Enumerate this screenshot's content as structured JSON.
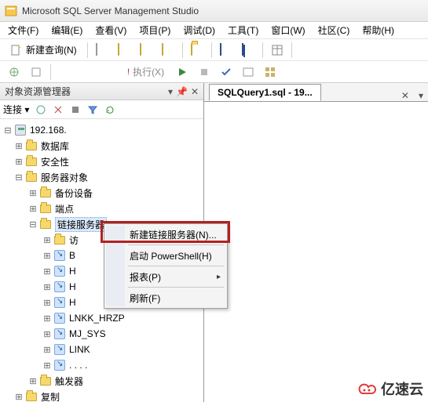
{
  "title": "Microsoft SQL Server Management Studio",
  "menu": {
    "file": "文件(F)",
    "edit": "编辑(E)",
    "view": "查看(V)",
    "project": "项目(P)",
    "debug": "调试(D)",
    "tools": "工具(T)",
    "window": "窗口(W)",
    "community": "社区(C)",
    "help": "帮助(H)"
  },
  "toolbar": {
    "new_query": "新建查询(N)",
    "execute": "执行(X)"
  },
  "explorer": {
    "title": "对象资源管理器",
    "connect_label": "连接 ▾",
    "root": "192.168.",
    "nodes": {
      "databases": "数据库",
      "security": "安全性",
      "server_objects": "服务器对象",
      "backup_devices": "备份设备",
      "endpoints": "端点",
      "linked_servers": "链接服务器",
      "l1": "访",
      "l2": "B",
      "l3": "H",
      "l4": "H",
      "l5": "H",
      "l6": "LNKK_HRZP",
      "l7": "MJ_SYS",
      "l8": "LINK",
      "l9": ". . . .",
      "triggers": "触发器",
      "replication": "复制"
    }
  },
  "tab": {
    "label": "SQLQuery1.sql - 19...",
    "close": "✕",
    "menu": "▾"
  },
  "context_menu": {
    "new_linked_server": "新建链接服务器(N)...",
    "start_powershell": "启动 PowerShell(H)",
    "reports": "报表(P)",
    "refresh": "刷新(F)"
  },
  "watermark": "亿速云"
}
